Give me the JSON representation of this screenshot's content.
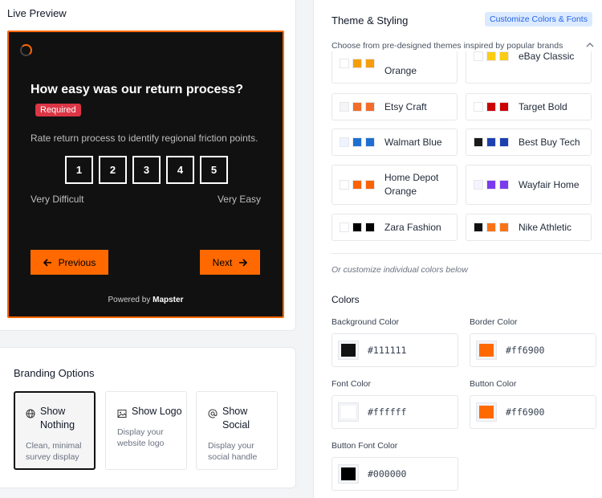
{
  "preview": {
    "title": "Live Preview",
    "survey": {
      "question": "How easy was our return process?",
      "required_badge": "Required",
      "helper": "Rate return process to identify regional friction points.",
      "scale": [
        "1",
        "2",
        "3",
        "4",
        "5"
      ],
      "min_label": "Very Difficult",
      "max_label": "Very Easy",
      "previous_label": "Previous",
      "next_label": "Next",
      "powered_prefix": "Powered by",
      "powered_brand": "Mapster"
    }
  },
  "branding": {
    "title": "Branding Options",
    "options": [
      {
        "name": "Show Nothing",
        "desc": "Clean, minimal survey display",
        "icon": "globe-icon",
        "selected": true
      },
      {
        "name": "Show Logo",
        "desc": "Display your website logo",
        "icon": "image-icon",
        "selected": false
      },
      {
        "name": "Show Social",
        "desc": "Display your social handle",
        "icon": "at-icon",
        "selected": false
      }
    ]
  },
  "theme": {
    "title": "Theme & Styling",
    "customize_badge": "Customize Colors & Fonts",
    "choose_text": "Choose from pre-designed themes inspired by popular brands",
    "themes": [
      {
        "name": "Orange",
        "colors": [
          "#ffffff",
          "#f59e0b",
          "#f59e0b"
        ]
      },
      {
        "name": "eBay Classic",
        "colors": [
          "#ffffff",
          "#facc15",
          "#facc15"
        ]
      },
      {
        "name": "Etsy Craft",
        "colors": [
          "#f5f5f5",
          "#f26c2a",
          "#f26c2a"
        ]
      },
      {
        "name": "Target Bold",
        "colors": [
          "#ffffff",
          "#cc0000",
          "#cc0000"
        ]
      },
      {
        "name": "Walmart Blue",
        "colors": [
          "#eef4ff",
          "#1f6fd1",
          "#1f6fd1"
        ]
      },
      {
        "name": "Best Buy Tech",
        "colors": [
          "#1a1a1a",
          "#1e40af",
          "#1e40af"
        ]
      },
      {
        "name": "Home Depot Orange",
        "colors": [
          "#ffffff",
          "#f96302",
          "#f96302"
        ]
      },
      {
        "name": "Wayfair Home",
        "colors": [
          "#f5f3ff",
          "#7c3aed",
          "#7c3aed"
        ]
      },
      {
        "name": "Zara Fashion",
        "colors": [
          "#ffffff",
          "#000000",
          "#000000"
        ]
      },
      {
        "name": "Nike Athletic",
        "colors": [
          "#111111",
          "#f97316",
          "#f97316"
        ]
      }
    ],
    "or_text": "Or customize individual colors below"
  },
  "colors": {
    "title": "Colors",
    "background": {
      "label": "Background Color",
      "value": "#111111"
    },
    "border": {
      "label": "Border Color",
      "value": "#ff6900"
    },
    "font": {
      "label": "Font Color",
      "value": "#ffffff"
    },
    "button": {
      "label": "Button Color",
      "value": "#ff6900"
    },
    "button_font": {
      "label": "Button Font Color",
      "value": "#000000"
    }
  }
}
